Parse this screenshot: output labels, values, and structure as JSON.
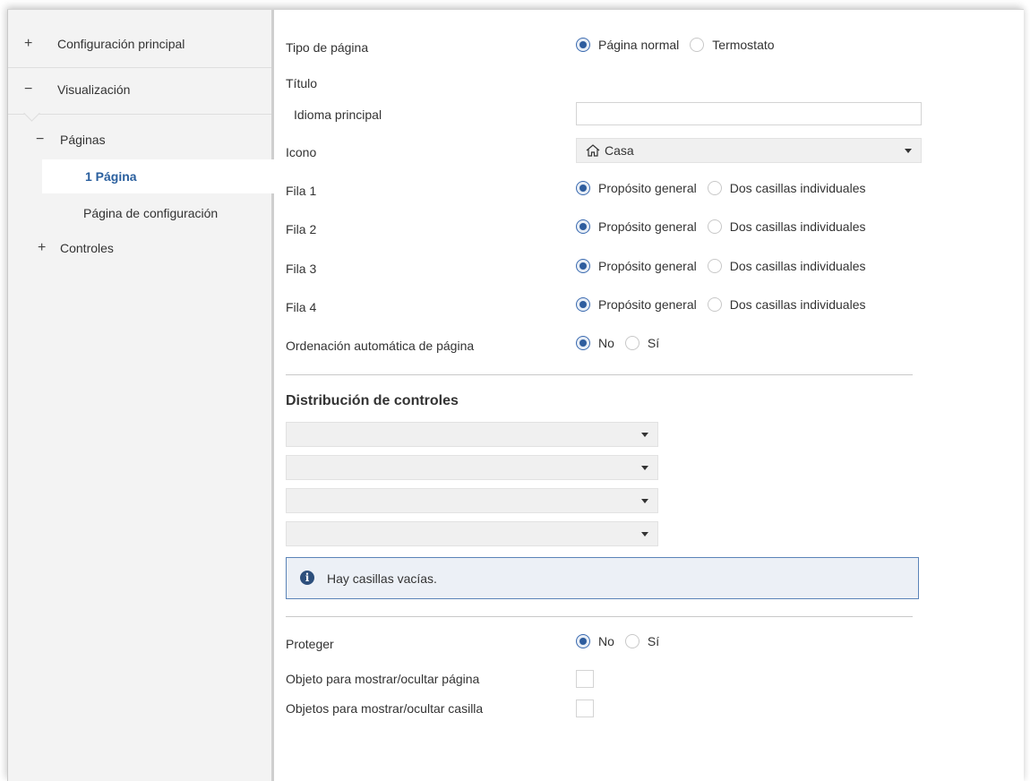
{
  "sidebar": {
    "items": [
      {
        "sign": "+",
        "label": "Configuración principal"
      },
      {
        "sign": "−",
        "label": "Visualización"
      },
      {
        "sign": "−",
        "label": "Páginas"
      },
      {
        "label": "1 Página"
      },
      {
        "label": "Página de configuración"
      },
      {
        "sign": "+",
        "label": "Controles"
      }
    ]
  },
  "form": {
    "tipo_pagina": {
      "label": "Tipo de página",
      "options": [
        "Página normal",
        "Termostato"
      ],
      "selected": "Página normal"
    },
    "titulo": {
      "label": "Título"
    },
    "idioma": {
      "label": "Idioma principal",
      "value": ""
    },
    "icono": {
      "label": "Icono",
      "icon": "home-icon",
      "value": "Casa"
    },
    "filas": [
      {
        "label": "Fila 1",
        "options": [
          "Propósito general",
          "Dos casillas individuales"
        ],
        "selected": "Propósito general"
      },
      {
        "label": "Fila 2",
        "options": [
          "Propósito general",
          "Dos casillas individuales"
        ],
        "selected": "Propósito general"
      },
      {
        "label": "Fila 3",
        "options": [
          "Propósito general",
          "Dos casillas individuales"
        ],
        "selected": "Propósito general"
      },
      {
        "label": "Fila 4",
        "options": [
          "Propósito general",
          "Dos casillas individuales"
        ],
        "selected": "Propósito general"
      }
    ],
    "ordenacion": {
      "label": "Ordenación automática de página",
      "options": [
        "No",
        "Sí"
      ],
      "selected": "No"
    },
    "distribucion": {
      "title": "Distribución de controles",
      "selects": [
        "",
        "",
        "",
        ""
      ]
    },
    "info": {
      "icon": "info-icon",
      "text": "Hay casillas vacías."
    },
    "proteger": {
      "label": "Proteger",
      "options": [
        "No",
        "Sí"
      ],
      "selected": "No"
    },
    "obj_pagina": {
      "label": "Objeto para mostrar/ocultar página",
      "checked": false
    },
    "obj_casilla": {
      "label": "Objetos para mostrar/ocultar casilla",
      "checked": false
    }
  },
  "colors": {
    "accent": "#2e5d9e",
    "selected_sidebar_text": "#2a5f9e",
    "info_border": "#5b84b8"
  }
}
